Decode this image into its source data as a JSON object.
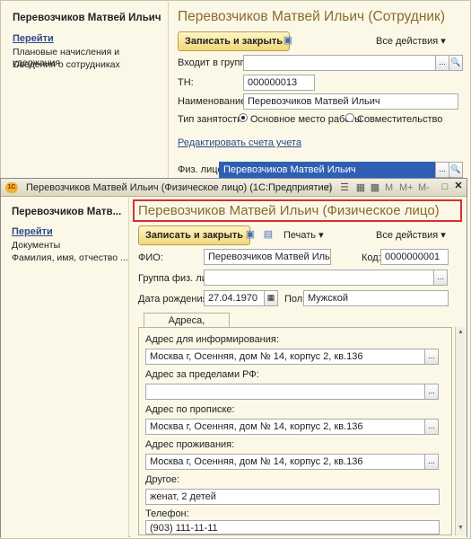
{
  "back": {
    "side_title": "Перевозчиков Матвей Ильич",
    "goto": "Перейти",
    "links": [
      "Плановые начисления и удержания",
      "Сведения о сотрудниках"
    ],
    "title": "Перевозчиков Матвей Ильич (Сотрудник)",
    "save_close": "Записать и закрыть",
    "all_actions": "Все действия ▾",
    "group_label": "Входит в группу:",
    "group_value": "",
    "tn_label": "ТН:",
    "tn_value": "000000013",
    "name_label": "Наименование:",
    "name_value": "Перевозчиков Матвей Ильич",
    "employment_label": "Тип занятости:",
    "employment_main": "Основное место работы",
    "employment_part": "Совместительство",
    "edit_accounts": "Редактировать счета учета",
    "person_label": "Физ. лицо:",
    "person_value": "Перевозчиков Матвей Ильич"
  },
  "front": {
    "window_title": "Перевозчиков Матвей Ильич (Физическое лицо) (1С:Предприятие)",
    "tb_m": "M",
    "tb_mplus": "M+",
    "tb_mminus": "M-",
    "side_title": "Перевозчиков Матв...",
    "goto": "Перейти",
    "links": [
      "Документы",
      "Фамилия, имя, отчество ..."
    ],
    "title": "Перевозчиков Матвей Ильич (Физическое лицо)",
    "save_close": "Записать и закрыть",
    "print": "Печать ▾",
    "all_actions": "Все действия ▾",
    "fio_label": "ФИО:",
    "fio_value": "Перевозчиков Матвей Ильич",
    "code_label": "Код:",
    "code_value": "0000000001",
    "group_label": "Группа физ. лиц:",
    "group_value": "",
    "birth_label": "Дата рождения:",
    "birth_value": "27.04.1970",
    "sex_label": "Пол:",
    "sex_value": "Мужской",
    "tab": "Адреса, телефоны",
    "addr_info_label": "Адрес для информирования:",
    "addr_info_value": "Москва г, Осенняя, дом № 14, корпус 2, кв.136",
    "addr_abroad_label": "Адрес за пределами РФ:",
    "addr_abroad_value": "",
    "addr_reg_label": "Адрес по прописке:",
    "addr_reg_value": "Москва г, Осенняя, дом № 14, корпус 2, кв.136",
    "addr_live_label": "Адрес проживания:",
    "addr_live_value": "Москва г, Осенняя, дом № 14, корпус 2, кв.136",
    "other_label": "Другое:",
    "other_value": "женат, 2 детей",
    "phone_label": "Телефон:",
    "phone_value": "(903) 111-11-11"
  },
  "colors": {
    "title": "#8a6a2a",
    "highlight_border": "#d9302b",
    "selection": "#2f5fb3"
  }
}
